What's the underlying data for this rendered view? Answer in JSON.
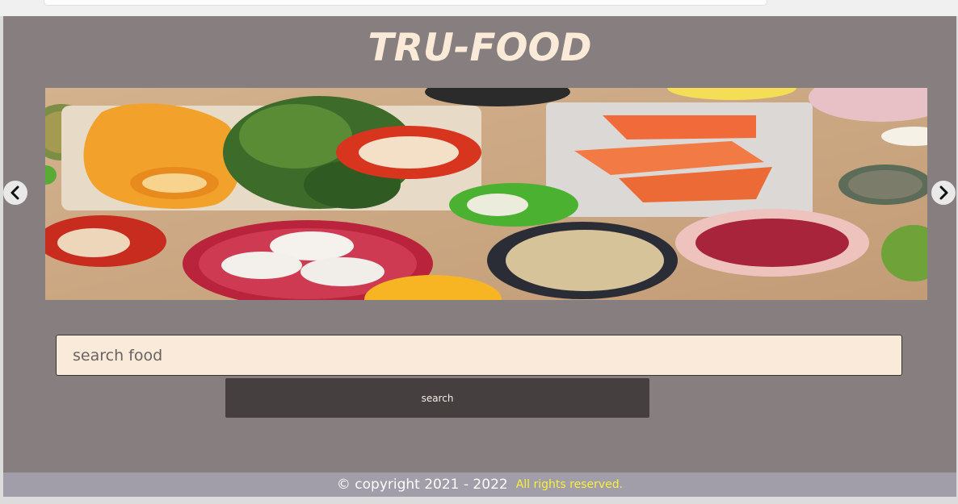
{
  "header": {
    "title": "TRU-FOOD"
  },
  "carousel": {
    "prev_icon": "chevron-left-icon",
    "next_icon": "chevron-right-icon"
  },
  "search": {
    "placeholder": "search food",
    "value": "",
    "button_label": "search"
  },
  "footer": {
    "copyright": "©  copyright 2021 - 2022",
    "rights": "All rights reserved."
  },
  "colors": {
    "page_bg": "#877f7f",
    "title": "#fbead7",
    "input_bg": "#faeada",
    "button_bg": "#463f3f",
    "footer_bg": "#a19da9",
    "rights_text": "#f6f23a"
  }
}
